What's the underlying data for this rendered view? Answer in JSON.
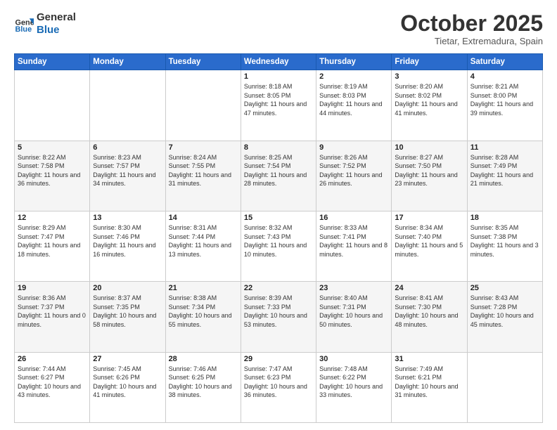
{
  "logo": {
    "general": "General",
    "blue": "Blue"
  },
  "header": {
    "month": "October 2025",
    "location": "Tietar, Extremadura, Spain"
  },
  "weekdays": [
    "Sunday",
    "Monday",
    "Tuesday",
    "Wednesday",
    "Thursday",
    "Friday",
    "Saturday"
  ],
  "weeks": [
    [
      {
        "day": "",
        "sunrise": "",
        "sunset": "",
        "daylight": ""
      },
      {
        "day": "",
        "sunrise": "",
        "sunset": "",
        "daylight": ""
      },
      {
        "day": "",
        "sunrise": "",
        "sunset": "",
        "daylight": ""
      },
      {
        "day": "1",
        "sunrise": "Sunrise: 8:18 AM",
        "sunset": "Sunset: 8:05 PM",
        "daylight": "Daylight: 11 hours and 47 minutes."
      },
      {
        "day": "2",
        "sunrise": "Sunrise: 8:19 AM",
        "sunset": "Sunset: 8:03 PM",
        "daylight": "Daylight: 11 hours and 44 minutes."
      },
      {
        "day": "3",
        "sunrise": "Sunrise: 8:20 AM",
        "sunset": "Sunset: 8:02 PM",
        "daylight": "Daylight: 11 hours and 41 minutes."
      },
      {
        "day": "4",
        "sunrise": "Sunrise: 8:21 AM",
        "sunset": "Sunset: 8:00 PM",
        "daylight": "Daylight: 11 hours and 39 minutes."
      }
    ],
    [
      {
        "day": "5",
        "sunrise": "Sunrise: 8:22 AM",
        "sunset": "Sunset: 7:58 PM",
        "daylight": "Daylight: 11 hours and 36 minutes."
      },
      {
        "day": "6",
        "sunrise": "Sunrise: 8:23 AM",
        "sunset": "Sunset: 7:57 PM",
        "daylight": "Daylight: 11 hours and 34 minutes."
      },
      {
        "day": "7",
        "sunrise": "Sunrise: 8:24 AM",
        "sunset": "Sunset: 7:55 PM",
        "daylight": "Daylight: 11 hours and 31 minutes."
      },
      {
        "day": "8",
        "sunrise": "Sunrise: 8:25 AM",
        "sunset": "Sunset: 7:54 PM",
        "daylight": "Daylight: 11 hours and 28 minutes."
      },
      {
        "day": "9",
        "sunrise": "Sunrise: 8:26 AM",
        "sunset": "Sunset: 7:52 PM",
        "daylight": "Daylight: 11 hours and 26 minutes."
      },
      {
        "day": "10",
        "sunrise": "Sunrise: 8:27 AM",
        "sunset": "Sunset: 7:50 PM",
        "daylight": "Daylight: 11 hours and 23 minutes."
      },
      {
        "day": "11",
        "sunrise": "Sunrise: 8:28 AM",
        "sunset": "Sunset: 7:49 PM",
        "daylight": "Daylight: 11 hours and 21 minutes."
      }
    ],
    [
      {
        "day": "12",
        "sunrise": "Sunrise: 8:29 AM",
        "sunset": "Sunset: 7:47 PM",
        "daylight": "Daylight: 11 hours and 18 minutes."
      },
      {
        "day": "13",
        "sunrise": "Sunrise: 8:30 AM",
        "sunset": "Sunset: 7:46 PM",
        "daylight": "Daylight: 11 hours and 16 minutes."
      },
      {
        "day": "14",
        "sunrise": "Sunrise: 8:31 AM",
        "sunset": "Sunset: 7:44 PM",
        "daylight": "Daylight: 11 hours and 13 minutes."
      },
      {
        "day": "15",
        "sunrise": "Sunrise: 8:32 AM",
        "sunset": "Sunset: 7:43 PM",
        "daylight": "Daylight: 11 hours and 10 minutes."
      },
      {
        "day": "16",
        "sunrise": "Sunrise: 8:33 AM",
        "sunset": "Sunset: 7:41 PM",
        "daylight": "Daylight: 11 hours and 8 minutes."
      },
      {
        "day": "17",
        "sunrise": "Sunrise: 8:34 AM",
        "sunset": "Sunset: 7:40 PM",
        "daylight": "Daylight: 11 hours and 5 minutes."
      },
      {
        "day": "18",
        "sunrise": "Sunrise: 8:35 AM",
        "sunset": "Sunset: 7:38 PM",
        "daylight": "Daylight: 11 hours and 3 minutes."
      }
    ],
    [
      {
        "day": "19",
        "sunrise": "Sunrise: 8:36 AM",
        "sunset": "Sunset: 7:37 PM",
        "daylight": "Daylight: 11 hours and 0 minutes."
      },
      {
        "day": "20",
        "sunrise": "Sunrise: 8:37 AM",
        "sunset": "Sunset: 7:35 PM",
        "daylight": "Daylight: 10 hours and 58 minutes."
      },
      {
        "day": "21",
        "sunrise": "Sunrise: 8:38 AM",
        "sunset": "Sunset: 7:34 PM",
        "daylight": "Daylight: 10 hours and 55 minutes."
      },
      {
        "day": "22",
        "sunrise": "Sunrise: 8:39 AM",
        "sunset": "Sunset: 7:33 PM",
        "daylight": "Daylight: 10 hours and 53 minutes."
      },
      {
        "day": "23",
        "sunrise": "Sunrise: 8:40 AM",
        "sunset": "Sunset: 7:31 PM",
        "daylight": "Daylight: 10 hours and 50 minutes."
      },
      {
        "day": "24",
        "sunrise": "Sunrise: 8:41 AM",
        "sunset": "Sunset: 7:30 PM",
        "daylight": "Daylight: 10 hours and 48 minutes."
      },
      {
        "day": "25",
        "sunrise": "Sunrise: 8:43 AM",
        "sunset": "Sunset: 7:28 PM",
        "daylight": "Daylight: 10 hours and 45 minutes."
      }
    ],
    [
      {
        "day": "26",
        "sunrise": "Sunrise: 7:44 AM",
        "sunset": "Sunset: 6:27 PM",
        "daylight": "Daylight: 10 hours and 43 minutes."
      },
      {
        "day": "27",
        "sunrise": "Sunrise: 7:45 AM",
        "sunset": "Sunset: 6:26 PM",
        "daylight": "Daylight: 10 hours and 41 minutes."
      },
      {
        "day": "28",
        "sunrise": "Sunrise: 7:46 AM",
        "sunset": "Sunset: 6:25 PM",
        "daylight": "Daylight: 10 hours and 38 minutes."
      },
      {
        "day": "29",
        "sunrise": "Sunrise: 7:47 AM",
        "sunset": "Sunset: 6:23 PM",
        "daylight": "Daylight: 10 hours and 36 minutes."
      },
      {
        "day": "30",
        "sunrise": "Sunrise: 7:48 AM",
        "sunset": "Sunset: 6:22 PM",
        "daylight": "Daylight: 10 hours and 33 minutes."
      },
      {
        "day": "31",
        "sunrise": "Sunrise: 7:49 AM",
        "sunset": "Sunset: 6:21 PM",
        "daylight": "Daylight: 10 hours and 31 minutes."
      },
      {
        "day": "",
        "sunrise": "",
        "sunset": "",
        "daylight": ""
      }
    ]
  ]
}
